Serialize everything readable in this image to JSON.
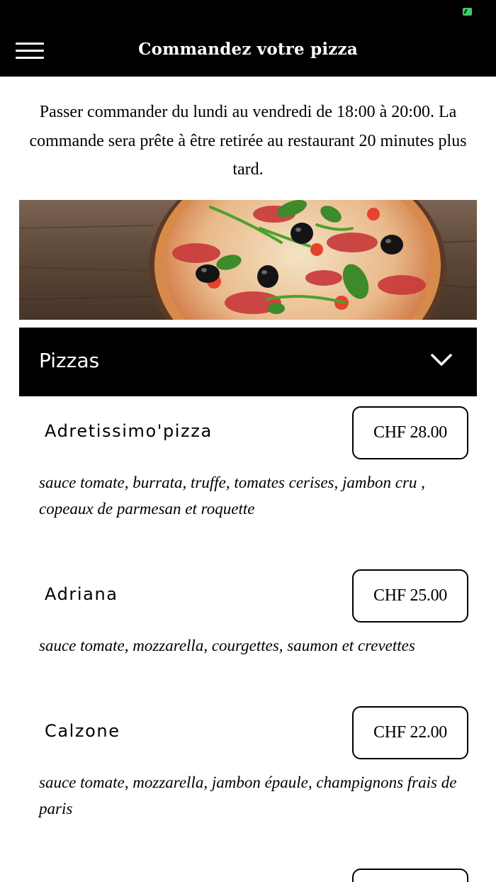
{
  "header": {
    "title": "Commandez votre pizza",
    "menu_icon": "hamburger-menu-icon",
    "background": "#000000"
  },
  "intro": {
    "text": "Passer commander du lundi au vendredi de 18:00 à 20:00. La commande sera prête à être retirée au restaurant 20 minutes plus tard."
  },
  "category": {
    "title": "Pizzas",
    "icon": "chevron-down-icon"
  },
  "items": [
    {
      "name": "Adretissimo'pizza",
      "price": "CHF 28.00",
      "description": "sauce tomate, burrata, truffe, tomates cerises, jambon cru , copeaux de parmesan et roquette"
    },
    {
      "name": "Adriana",
      "price": "CHF 25.00",
      "description": "sauce tomate, mozzarella, courgettes, saumon et crevettes"
    },
    {
      "name": "Calzone",
      "price": "CHF 22.00",
      "description": "sauce tomate, mozzarella, jambon épaule, champignons frais de paris"
    }
  ]
}
